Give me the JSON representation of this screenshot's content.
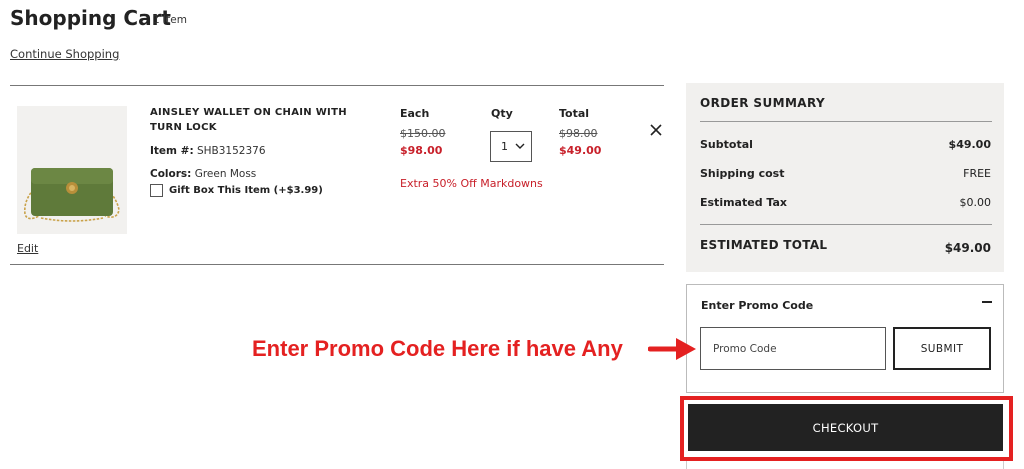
{
  "header": {
    "title": "Shopping Cart",
    "item_count": "1 Item",
    "continue_link": "Continue Shopping"
  },
  "cart_item": {
    "name": "AINSLEY WALLET ON CHAIN WITH TURN LOCK",
    "item_number_label": "Item #:",
    "item_number": "SHB3152376",
    "colors_label": "Colors:",
    "color": "Green Moss",
    "gift_box_label": "Gift Box This Item (+$3.99)",
    "gift_box_checked": false,
    "edit_link": "Edit",
    "each_header": "Each",
    "qty_header": "Qty",
    "total_header": "Total",
    "each_original": "$150.00",
    "each_sale": "$98.00",
    "qty_value": "1",
    "total_original": "$98.00",
    "total_sale": "$49.00",
    "promo_note": "Extra 50% Off Markdowns",
    "product_color": "#5f7a3a"
  },
  "order_summary": {
    "title": "ORDER SUMMARY",
    "rows": [
      {
        "label": "Subtotal",
        "value": "$49.00"
      },
      {
        "label": "Shipping cost",
        "value": "FREE"
      },
      {
        "label": "Estimated Tax",
        "value": "$0.00"
      }
    ],
    "total_label": "ESTIMATED TOTAL",
    "total_value": "$49.00"
  },
  "promo": {
    "heading": "Enter Promo Code",
    "placeholder": "Promo Code",
    "submit_label": "SUBMIT"
  },
  "checkout": {
    "label": "CHECKOUT"
  },
  "annotation": {
    "text": "Enter Promo Code Here if have Any",
    "color": "#e42121"
  },
  "colors": {
    "sale_red": "#c8202a",
    "button_dark": "#222222",
    "summary_bg": "#f1f0ee"
  }
}
